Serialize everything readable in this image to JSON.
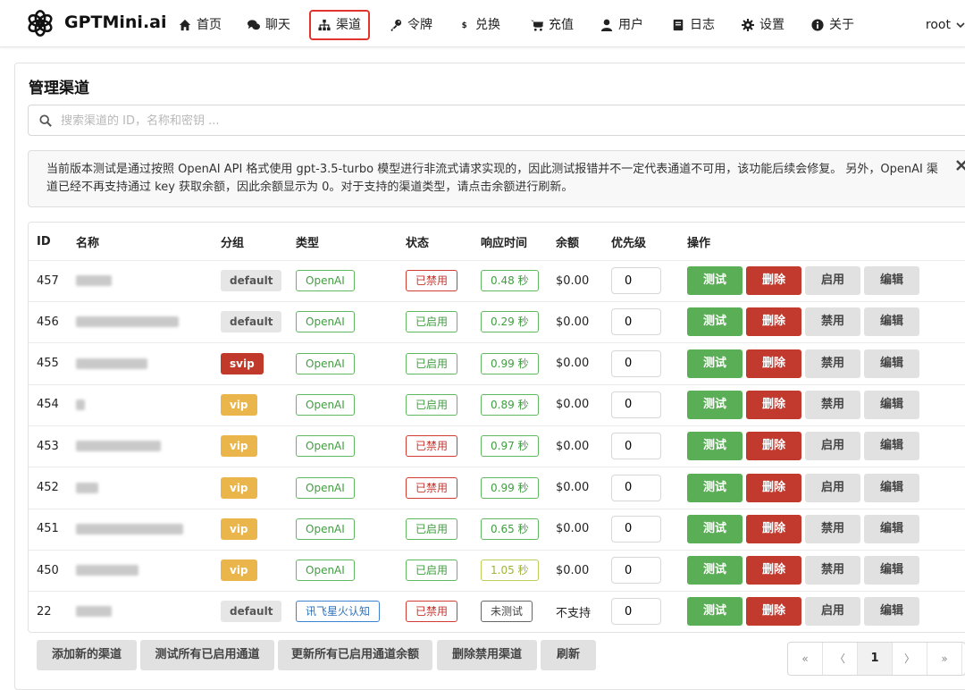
{
  "app": {
    "brand": "GPTMini.ai"
  },
  "nav": {
    "items": [
      {
        "label": "首页",
        "icon": "home-icon"
      },
      {
        "label": "聊天",
        "icon": "chat-icon"
      },
      {
        "label": "渠道",
        "icon": "sitemap-icon",
        "active": true
      },
      {
        "label": "令牌",
        "icon": "key-icon"
      },
      {
        "label": "兑换",
        "icon": "dollar-icon"
      },
      {
        "label": "充值",
        "icon": "cart-icon"
      },
      {
        "label": "用户",
        "icon": "user-icon"
      },
      {
        "label": "日志",
        "icon": "book-icon"
      },
      {
        "label": "设置",
        "icon": "gear-icon"
      },
      {
        "label": "关于",
        "icon": "info-icon"
      }
    ],
    "user": "root"
  },
  "page": {
    "title": "管理渠道",
    "search_placeholder": "搜索渠道的 ID，名称和密钥 ...",
    "notice_line1": "当前版本测试是通过按照 OpenAI API 格式使用 gpt-3.5-turbo 模型进行非流式请求实现的，因此测试报错并不一定代表通道不可用，该功能后续会修复。 另外，OpenAI 渠",
    "notice_line2": "道已经不再支持通过 key 获取余额，因此余额显示为 0。对于支持的渠道类型，请点击余额进行刷新。"
  },
  "table": {
    "headers": [
      "ID",
      "名称",
      "分组",
      "类型",
      "状态",
      "响应时间",
      "余额",
      "优先级",
      "操作"
    ],
    "rows": [
      {
        "id": "457",
        "group": "default",
        "type": "OpenAI",
        "status": "已禁用",
        "response": "0.48 秒",
        "balance": "$0.00",
        "priority": "0",
        "toggle": "启用"
      },
      {
        "id": "456",
        "group": "default",
        "type": "OpenAI",
        "status": "已启用",
        "response": "0.29 秒",
        "balance": "$0.00",
        "priority": "0",
        "toggle": "禁用"
      },
      {
        "id": "455",
        "group": "svip",
        "type": "OpenAI",
        "status": "已启用",
        "response": "0.99 秒",
        "balance": "$0.00",
        "priority": "0",
        "toggle": "禁用"
      },
      {
        "id": "454",
        "group": "vip",
        "type": "OpenAI",
        "status": "已启用",
        "response": "0.89 秒",
        "balance": "$0.00",
        "priority": "0",
        "toggle": "禁用"
      },
      {
        "id": "453",
        "group": "vip",
        "type": "OpenAI",
        "status": "已禁用",
        "response": "0.97 秒",
        "balance": "$0.00",
        "priority": "0",
        "toggle": "启用"
      },
      {
        "id": "452",
        "group": "vip",
        "type": "OpenAI",
        "status": "已禁用",
        "response": "0.99 秒",
        "balance": "$0.00",
        "priority": "0",
        "toggle": "启用"
      },
      {
        "id": "451",
        "group": "vip",
        "type": "OpenAI",
        "status": "已启用",
        "response": "0.65 秒",
        "balance": "$0.00",
        "priority": "0",
        "toggle": "禁用"
      },
      {
        "id": "450",
        "group": "vip",
        "type": "OpenAI",
        "status": "已启用",
        "response": "1.05 秒",
        "balance": "$0.00",
        "priority": "0",
        "toggle": "禁用"
      },
      {
        "id": "22",
        "group": "default",
        "type": "讯飞星火认知",
        "status": "已禁用",
        "response": "未测试",
        "balance": "不支持",
        "priority": "0",
        "toggle": "启用"
      }
    ],
    "actions": {
      "test": "测试",
      "delete": "删除",
      "edit": "编辑"
    }
  },
  "footer": {
    "buttons": [
      "添加新的渠道",
      "测试所有已启用通道",
      "更新所有已启用通道余额",
      "删除禁用渠道",
      "刷新"
    ],
    "pager": {
      "first": "«",
      "prev": "〈",
      "current": "1",
      "next": "〉",
      "last": "»"
    }
  },
  "colors": {
    "accent_red": "#e0342d",
    "test_green": "#5aae55",
    "delete_red": "#c2392e",
    "vip_yellow": "#eab64b",
    "svip_red": "#c0392b"
  }
}
